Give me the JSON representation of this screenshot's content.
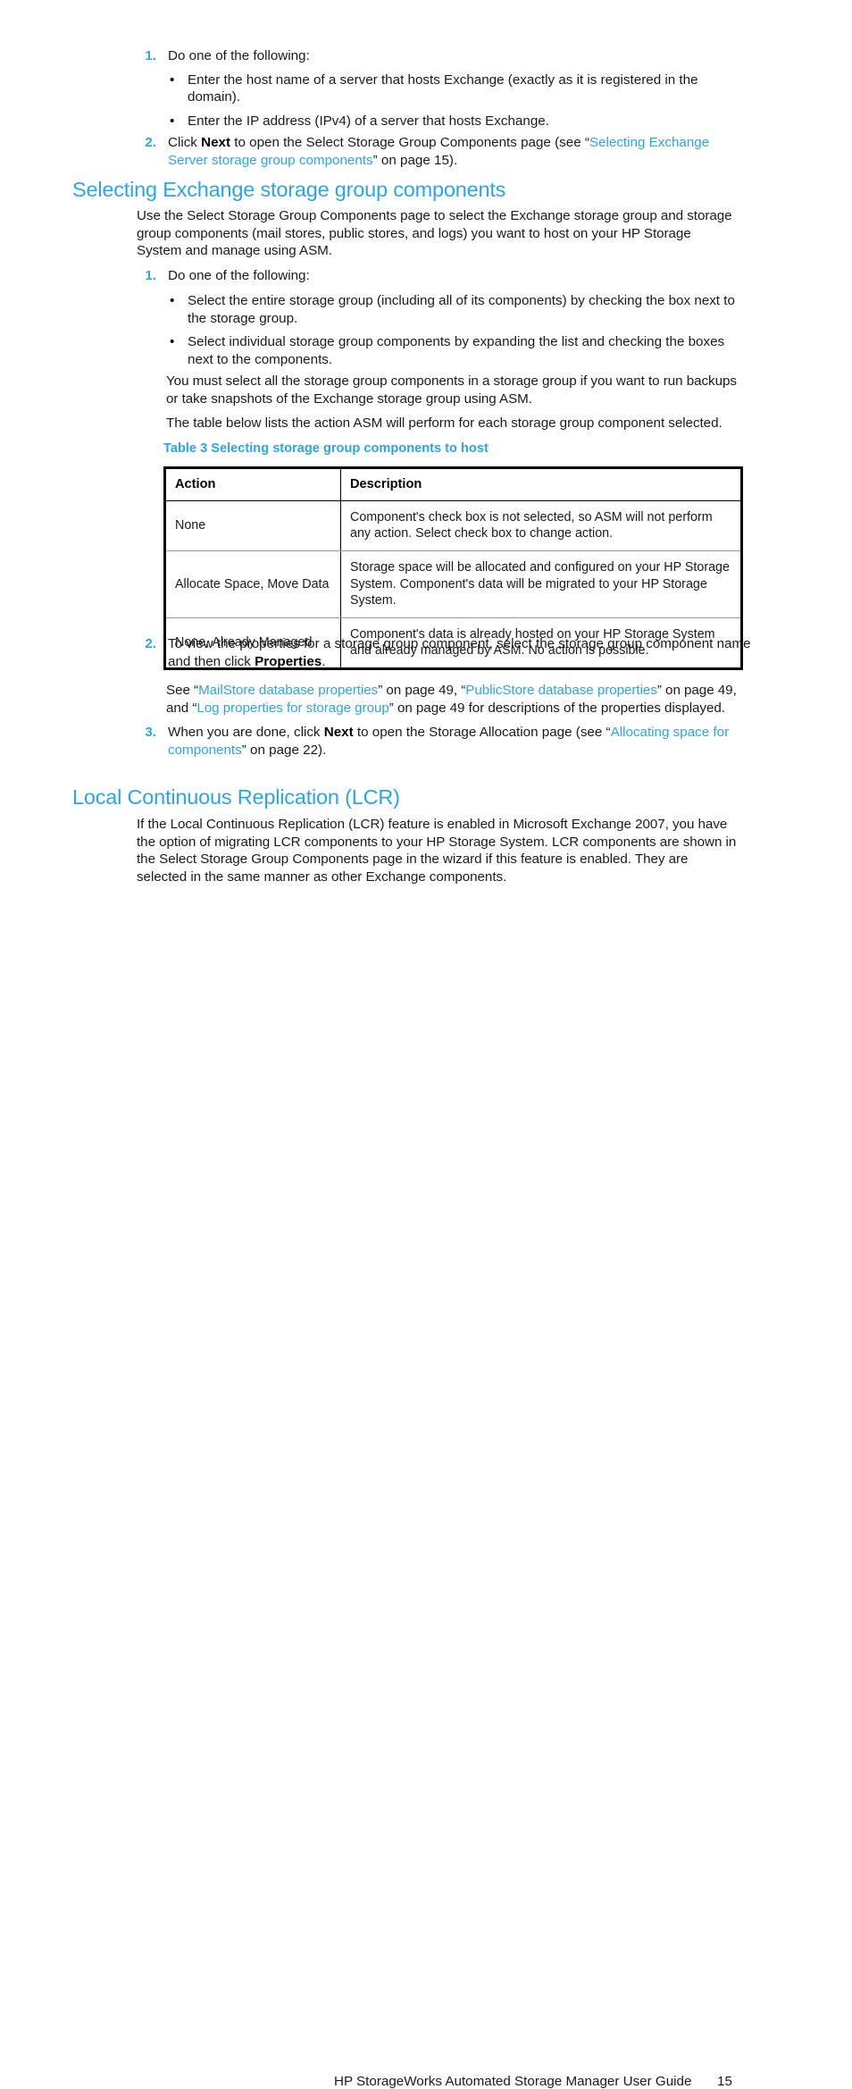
{
  "page": {
    "number": "15",
    "accent_color": "#2BA6DE",
    "body_color": "#1a1a1a",
    "footer_title": "HP StorageWorks Automated Storage Manager User Guide"
  },
  "top_list": {
    "item1": {
      "number": "1.",
      "text": "Do one of the following:",
      "bullets": [
        {
          "dot": "•",
          "text": "Enter the host name of a server that hosts Exchange (exactly as it is registered in the domain)."
        },
        {
          "dot": "•",
          "text": "Enter the IP address (IPv4) of a server that hosts Exchange."
        }
      ]
    },
    "item2": {
      "number": "2.",
      "pre": "Click ",
      "bold": "Next",
      "mid": " to open the Select Storage Group Components page (see “",
      "link": "Selecting Exchange Server storage group components",
      "post": "” on page 15)."
    }
  },
  "section_selecting": {
    "heading": "Selecting Exchange storage group components",
    "intro": "Use the Select Storage Group Components page to select the Exchange storage group and storage group components (mail stores, public stores, and logs) you want to host on your HP Storage System and manage using ASM.",
    "step1": {
      "number": "1.",
      "text": "Do one of the following:",
      "bullets": [
        {
          "dot": "•",
          "text": "Select the entire storage group (including all of its components) by checking the box next to the storage group."
        },
        {
          "dot": "•",
          "text": "Select individual storage group components by expanding the list and checking the boxes next to the components."
        }
      ],
      "para1": "You must select all the storage group components in a storage group if you want to run backups or take snapshots of the Exchange storage group using ASM.",
      "para2": "The table below lists the action ASM will perform for each storage group component selected."
    },
    "table": {
      "caption": "Table 3 Selecting storage group components to host",
      "columns": [
        "Action",
        "Description"
      ],
      "rows": [
        {
          "action": "None",
          "description": "Component's check box is not selected, so ASM will not perform any action. Select check box to change action."
        },
        {
          "action": "Allocate Space, Move Data",
          "description": "Storage space will be allocated and configured on your HP Storage System. Component's data will be migrated to your HP Storage System."
        },
        {
          "action": "None, Already Managed",
          "description": "Component's data is already hosted on your HP Storage System and already managed by ASM. No action is possible."
        }
      ]
    },
    "step2": {
      "number": "2.",
      "pre": "To view the properties for a storage group component, select the storage group component name and then click ",
      "bold": "Properties",
      "post": ".",
      "see_pre": "See “",
      "see_link1": "MailStore database properties",
      "see_mid1": "” on page 49, “",
      "see_link2": "PublicStore database properties",
      "see_mid2": "” on page 49, and “",
      "see_link3": "Log properties for storage group",
      "see_post": "” on page 49 for descriptions of the properties displayed."
    },
    "step3": {
      "number": "3.",
      "pre": "When you are done, click ",
      "bold": "Next",
      "mid": " to open the Storage Allocation page (see “",
      "link": "Allocating space for components",
      "post": "” on page 22)."
    }
  },
  "section_lcr": {
    "heading": "Local Continuous Replication (LCR)",
    "paragraph": "If the Local Continuous Replication (LCR) feature is enabled in Microsoft Exchange 2007, you have the option of migrating LCR components to your HP Storage System. LCR components are shown in the Select Storage Group Components page in the wizard if this feature is enabled. They are selected in the same manner as other Exchange components."
  }
}
